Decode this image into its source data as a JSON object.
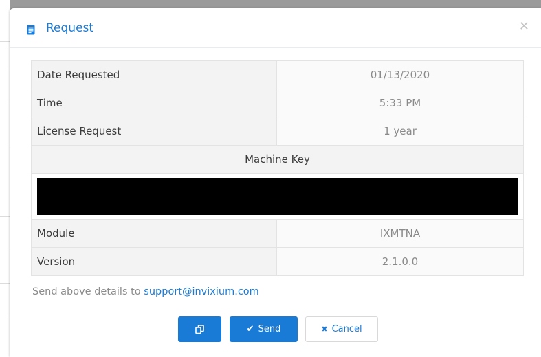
{
  "dialog": {
    "title": "Request",
    "close_glyph": "✕"
  },
  "details": {
    "rows": [
      {
        "label": "Date Requested",
        "value": "01/13/2020"
      },
      {
        "label": "Time",
        "value": "5:33 PM"
      },
      {
        "label": "License Request",
        "value": "1 year"
      }
    ],
    "machine_key_label": "Machine Key",
    "rows_after": [
      {
        "label": "Module",
        "value": "IXMTNA"
      },
      {
        "label": "Version",
        "value": "2.1.0.0"
      }
    ]
  },
  "note": {
    "text": "Send above details to ",
    "email": "support@invixium.com"
  },
  "buttons": {
    "copy_icon": "copy-icon",
    "send_label": "Send",
    "send_icon_glyph": "✔",
    "cancel_label": "Cancel",
    "cancel_icon_glyph": "✖"
  },
  "colors": {
    "accent": "#1a7bd6",
    "redacted": "#000000"
  }
}
